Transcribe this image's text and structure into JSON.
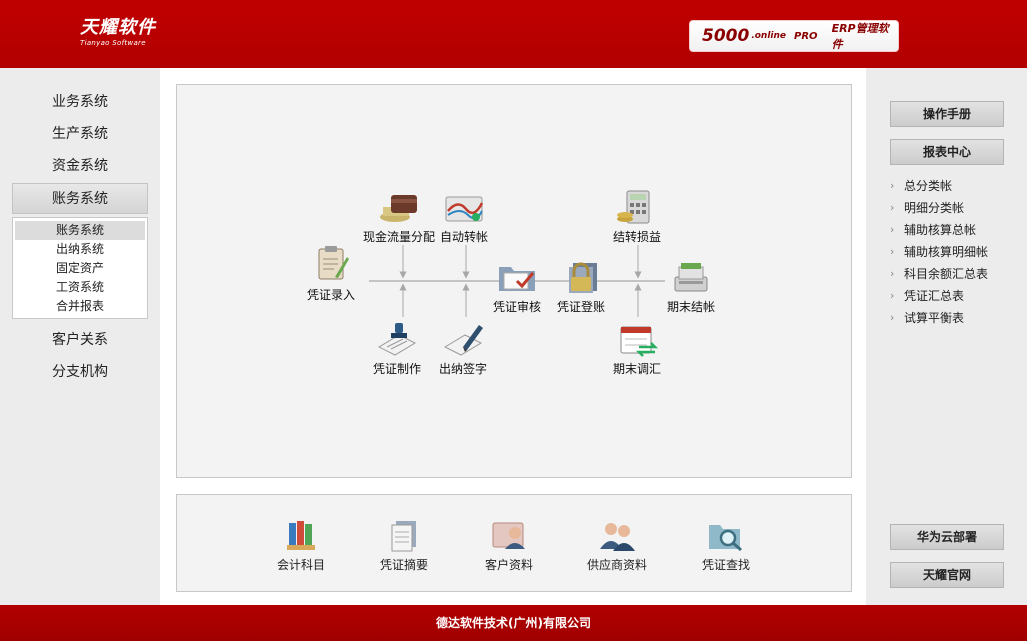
{
  "header": {
    "logo_cn": "天耀软件",
    "logo_en": "Tianyao Software",
    "product_version": "5000",
    "product_sub": ".online",
    "product_edition": "PRO",
    "product_name": "ERP管理软件"
  },
  "left_nav": {
    "items": [
      "业务系统",
      "生产系统",
      "资金系统",
      "账务系统",
      "客户关系",
      "分支机构"
    ],
    "active": "账务系统",
    "sub_items": [
      "账务系统",
      "出纳系统",
      "固定资产",
      "工资系统",
      "合并报表"
    ],
    "sub_active": "账务系统"
  },
  "flow": {
    "voucher_entry": "凭证录入",
    "cash_flow": "现金流量分配",
    "auto_transfer": "自动转帐",
    "voucher_make": "凭证制作",
    "cashier_sign": "出纳签字",
    "voucher_audit": "凭证审核",
    "voucher_post": "凭证登账",
    "carry_forward": "结转损益",
    "period_adjust": "期末调汇",
    "period_close": "期末结帐"
  },
  "quick": {
    "items": [
      "会计科目",
      "凭证摘要",
      "客户资料",
      "供应商资料",
      "凭证查找"
    ]
  },
  "right_panel": {
    "manual_button": "操作手册",
    "report_center_button": "报表中心",
    "reports": [
      "总分类帐",
      "明细分类帐",
      "辅助核算总帐",
      "辅助核算明细帐",
      "科目余额汇总表",
      "凭证汇总表",
      "试算平衡表"
    ],
    "huawei_button": "华为云部署",
    "official_button": "天耀官网"
  },
  "footer": {
    "company": "德达软件技术(广州)有限公司"
  },
  "colors": {
    "brand_red": "#b20000",
    "panel_bg": "#f3f3f3",
    "sidebar_bg": "#ececec"
  }
}
